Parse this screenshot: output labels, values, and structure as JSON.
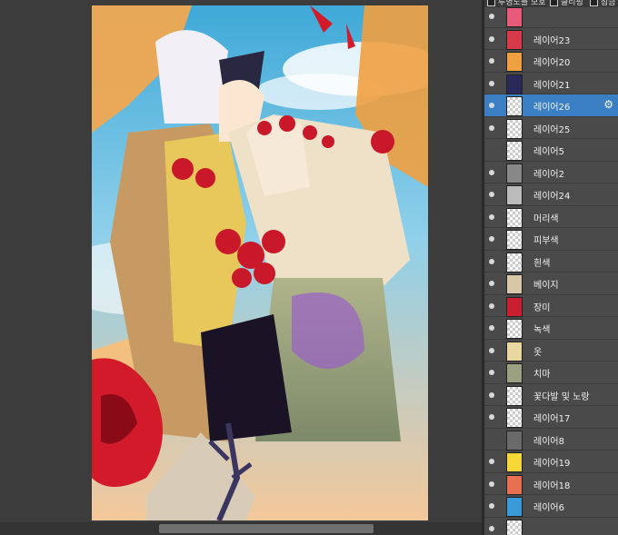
{
  "panel": {
    "options": [
      "투명도를 보호",
      "클리핑",
      "잠금"
    ]
  },
  "layers": [
    {
      "name": "",
      "visible": true,
      "thumb": "#e85a7a",
      "selected": false
    },
    {
      "name": "레이어23",
      "visible": true,
      "thumb": "#d83a4a",
      "selected": false
    },
    {
      "name": "레이어20",
      "visible": true,
      "thumb": "#f0a040",
      "selected": false
    },
    {
      "name": "레이어21",
      "visible": true,
      "thumb": "#2a2a5a",
      "selected": false
    },
    {
      "name": "레이어26",
      "visible": true,
      "thumb": "",
      "selected": true
    },
    {
      "name": "레이어25",
      "visible": true,
      "thumb": "",
      "selected": false
    },
    {
      "name": "레이어5",
      "visible": false,
      "thumb": "",
      "selected": false
    },
    {
      "name": "레이어2",
      "visible": true,
      "thumb": "#888888",
      "selected": false
    },
    {
      "name": "레이어24",
      "visible": true,
      "thumb": "#bbbbbb",
      "selected": false
    },
    {
      "name": "머리색",
      "visible": true,
      "thumb": "",
      "selected": false
    },
    {
      "name": "피부색",
      "visible": true,
      "thumb": "",
      "selected": false
    },
    {
      "name": "흰색",
      "visible": true,
      "thumb": "",
      "selected": false
    },
    {
      "name": "베이지",
      "visible": true,
      "thumb": "#d8c8a8",
      "selected": false
    },
    {
      "name": "장미",
      "visible": true,
      "thumb": "#c82030",
      "selected": false
    },
    {
      "name": "녹색",
      "visible": true,
      "thumb": "",
      "selected": false
    },
    {
      "name": "옷",
      "visible": true,
      "thumb": "#e8d8a0",
      "selected": false
    },
    {
      "name": "치마",
      "visible": true,
      "thumb": "#9aa080",
      "selected": false
    },
    {
      "name": "꽃다발 및 노랑",
      "visible": true,
      "thumb": "",
      "selected": false
    },
    {
      "name": "레이어17",
      "visible": true,
      "thumb": "",
      "selected": false
    },
    {
      "name": "레이어8",
      "visible": false,
      "thumb": "#6a6a6a",
      "selected": false
    },
    {
      "name": "레이어19",
      "visible": true,
      "thumb": "#f8d838",
      "selected": false
    },
    {
      "name": "레이어18",
      "visible": true,
      "thumb": "#e87050",
      "selected": false
    },
    {
      "name": "레이어6",
      "visible": true,
      "thumb": "#3a9ad8",
      "selected": false
    },
    {
      "name": "",
      "visible": true,
      "thumb": "",
      "selected": false
    }
  ],
  "colors": {
    "selection": "#3a7fc4",
    "panel_bg": "#4a4a4a",
    "canvas_bg": "#3c3c3c"
  },
  "icons": {
    "layer_settings": "gear-icon"
  }
}
